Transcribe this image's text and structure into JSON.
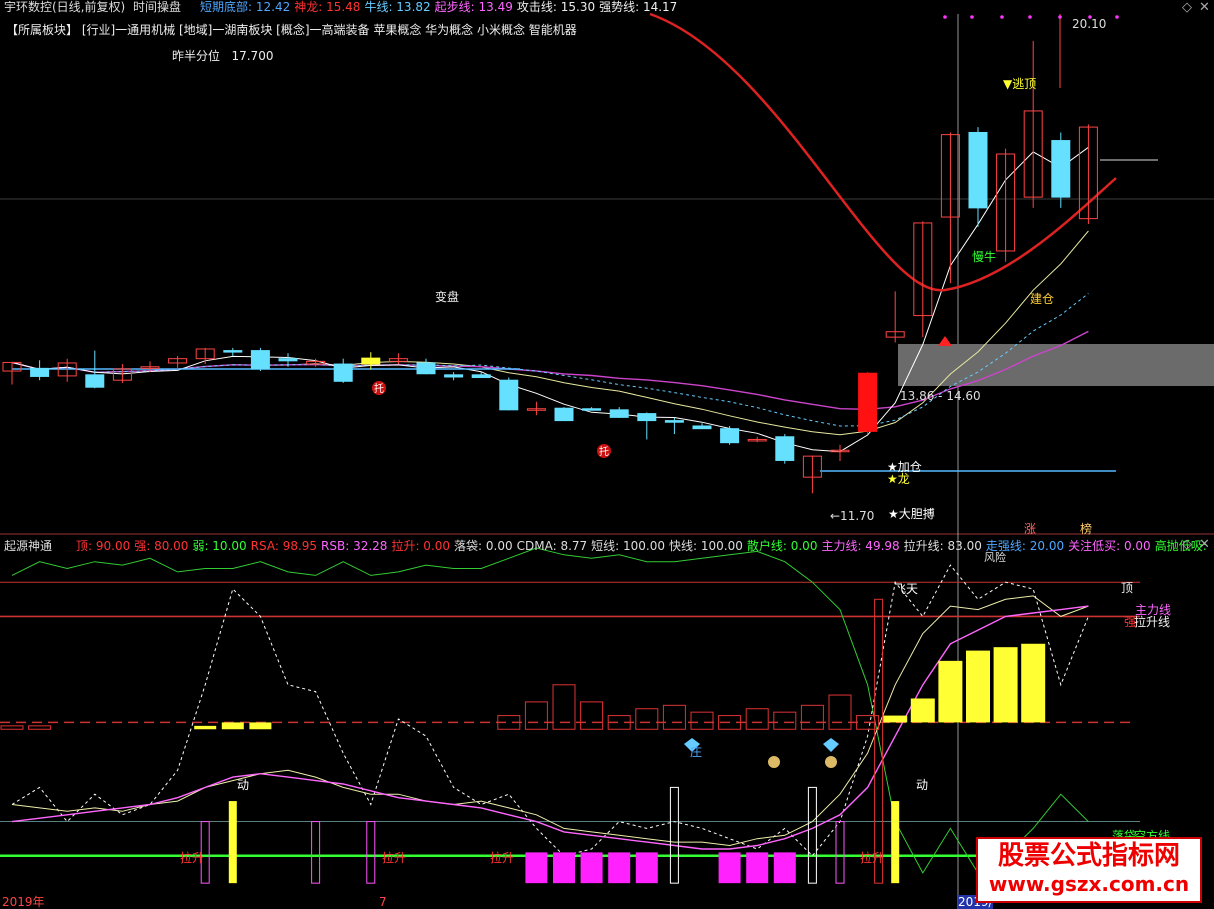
{
  "header": {
    "app_title": "宇环数控(日线,前复权)",
    "mode": "时间操盘",
    "items": [
      {
        "label": "短期底部:",
        "value": "12.42",
        "color": "#4ea6ff"
      },
      {
        "label": "神龙:",
        "value": "15.48",
        "color": "#ff3333"
      },
      {
        "label": "牛线:",
        "value": "13.82",
        "color": "#66ccff"
      },
      {
        "label": "起步线:",
        "value": "13.49",
        "color": "#ff66ff"
      },
      {
        "label": "攻击线:",
        "value": "15.30",
        "color": "#eeeeee"
      },
      {
        "label": "强势线:",
        "value": "14.17",
        "color": "#eeeeee"
      }
    ]
  },
  "sector_line": "【所属板块】 [行业]一通用机械 [地域]一湖南板块 [概念]一高端装备 苹果概念 华为概念 小米概念 智能机器",
  "half_year": {
    "label": "昨半分位",
    "value": "17.700"
  },
  "upper_labels": {
    "high": "20.10",
    "escape": "▼逃顶",
    "slow_bull": "慢牛",
    "build": "建仓",
    "change": "变盘",
    "range": "13.86 - 14.60",
    "add": "★加仓",
    "dragon": "★龙",
    "low": "←11.70",
    "bold": "★大胆搏",
    "zhang": "涨",
    "bang": "榜",
    "tuo": "托"
  },
  "lower_header": {
    "name": "起源神通",
    "items": [
      {
        "label": "顶:",
        "value": "90.00",
        "color": "#ff3333"
      },
      {
        "label": "强:",
        "value": "80.00",
        "color": "#ff3333"
      },
      {
        "label": "弱:",
        "value": "10.00",
        "color": "#33ff33"
      },
      {
        "label": "RSA:",
        "value": "98.95",
        "color": "#ff3333"
      },
      {
        "label": "RSB:",
        "value": "32.28",
        "color": "#ff66ff"
      },
      {
        "label": "拉升:",
        "value": "0.00",
        "color": "#ff3333"
      },
      {
        "label": "落袋:",
        "value": "0.00",
        "color": "#dddddd"
      },
      {
        "label": "CDMA:",
        "value": "8.77",
        "color": "#dddddd"
      },
      {
        "label": "短线:",
        "value": "100.00",
        "color": "#dddddd"
      },
      {
        "label": "快线:",
        "value": "100.00",
        "color": "#dddddd"
      },
      {
        "label": "散户线:",
        "value": "0.00",
        "color": "#33ff33"
      },
      {
        "label": "主力线:",
        "value": "49.98",
        "color": "#ff66ff"
      },
      {
        "label": "拉升线:",
        "value": "83.00",
        "color": "#dddddd"
      },
      {
        "label": "走强线:",
        "value": "20.00",
        "color": "#4ea6ff"
      },
      {
        "label": "关注低买:",
        "value": "0.00",
        "color": "#ff66ff"
      },
      {
        "label": "高抛低吸:",
        "value": "",
        "color": "#33ff33"
      }
    ]
  },
  "lower_labels": {
    "top": "顶",
    "main_line": "主力线",
    "lift_line": "拉升线",
    "fly": "飞天",
    "dong": "动",
    "zhuang": "庄",
    "lashen": "拉升",
    "luodai": "落袋",
    "kongfang": "空方线",
    "fengxian": "风险",
    "qiang": "强"
  },
  "dates": {
    "left": "2019年",
    "mid": "7",
    "right": "2019/"
  },
  "watermark": {
    "line1": "股票公式指标网",
    "line2": "www.gszx.com.cn"
  },
  "chart_data": {
    "type": "candlestick",
    "price_range": [
      11.0,
      20.6
    ],
    "candles": [
      {
        "o": 13.97,
        "h": 14.12,
        "l": 13.72,
        "c": 14.13
      },
      {
        "o": 14.02,
        "h": 14.17,
        "l": 13.8,
        "c": 13.87
      },
      {
        "o": 13.88,
        "h": 14.2,
        "l": 13.77,
        "c": 14.12
      },
      {
        "o": 13.9,
        "h": 14.35,
        "l": 13.65,
        "c": 13.67
      },
      {
        "o": 13.8,
        "h": 14.1,
        "l": 13.75,
        "c": 14.01
      },
      {
        "o": 14.02,
        "h": 14.15,
        "l": 13.95,
        "c": 14.05
      },
      {
        "o": 14.12,
        "h": 14.25,
        "l": 14.0,
        "c": 14.2
      },
      {
        "o": 14.2,
        "h": 14.4,
        "l": 14.1,
        "c": 14.38
      },
      {
        "o": 14.35,
        "h": 14.4,
        "l": 14.25,
        "c": 14.34
      },
      {
        "o": 14.35,
        "h": 14.4,
        "l": 13.97,
        "c": 14.01
      },
      {
        "o": 14.2,
        "h": 14.3,
        "l": 14.05,
        "c": 14.16
      },
      {
        "o": 14.1,
        "h": 14.2,
        "l": 14.05,
        "c": 14.15
      },
      {
        "o": 14.1,
        "h": 14.2,
        "l": 13.75,
        "c": 13.78
      },
      {
        "o": 14.1,
        "h": 14.32,
        "l": 14.0,
        "c": 14.21
      },
      {
        "o": 14.15,
        "h": 14.3,
        "l": 14.1,
        "c": 14.2
      },
      {
        "o": 14.12,
        "h": 14.2,
        "l": 13.91,
        "c": 13.92
      },
      {
        "o": 13.9,
        "h": 13.95,
        "l": 13.8,
        "c": 13.86
      },
      {
        "o": 13.9,
        "h": 13.95,
        "l": 13.85,
        "c": 13.85
      },
      {
        "o": 13.8,
        "h": 13.85,
        "l": 13.24,
        "c": 13.25
      },
      {
        "o": 13.25,
        "h": 13.4,
        "l": 13.15,
        "c": 13.27
      },
      {
        "o": 13.28,
        "h": 13.3,
        "l": 13.05,
        "c": 13.05
      },
      {
        "o": 13.27,
        "h": 13.3,
        "l": 13.24,
        "c": 13.25
      },
      {
        "o": 13.25,
        "h": 13.3,
        "l": 13.1,
        "c": 13.11
      },
      {
        "o": 13.18,
        "h": 13.2,
        "l": 12.7,
        "c": 13.05
      },
      {
        "o": 13.05,
        "h": 13.1,
        "l": 12.8,
        "c": 13.02
      },
      {
        "o": 12.95,
        "h": 13.0,
        "l": 12.9,
        "c": 12.9
      },
      {
        "o": 12.9,
        "h": 12.95,
        "l": 12.6,
        "c": 12.64
      },
      {
        "o": 12.7,
        "h": 12.75,
        "l": 12.65,
        "c": 12.7
      },
      {
        "o": 12.75,
        "h": 12.8,
        "l": 12.25,
        "c": 12.31
      },
      {
        "o": 12.0,
        "h": 12.4,
        "l": 11.7,
        "c": 12.39
      },
      {
        "o": 12.48,
        "h": 12.6,
        "l": 12.3,
        "c": 12.5
      },
      {
        "o": 12.85,
        "h": 13.95,
        "l": 12.8,
        "c": 13.93
      },
      {
        "o": 14.6,
        "h": 15.45,
        "l": 14.5,
        "c": 14.7
      },
      {
        "o": 15.0,
        "h": 16.75,
        "l": 14.6,
        "c": 16.72
      },
      {
        "o": 16.83,
        "h": 18.4,
        "l": 15.6,
        "c": 18.36
      },
      {
        "o": 18.4,
        "h": 18.5,
        "l": 16.65,
        "c": 17.0
      },
      {
        "o": 16.2,
        "h": 18.1,
        "l": 16.0,
        "c": 18.0
      },
      {
        "o": 17.2,
        "h": 20.1,
        "l": 17.0,
        "c": 18.8
      },
      {
        "o": 18.25,
        "h": 18.4,
        "l": 17.0,
        "c": 17.2
      },
      {
        "o": 16.8,
        "h": 18.55,
        "l": 16.7,
        "c": 18.5
      }
    ]
  }
}
